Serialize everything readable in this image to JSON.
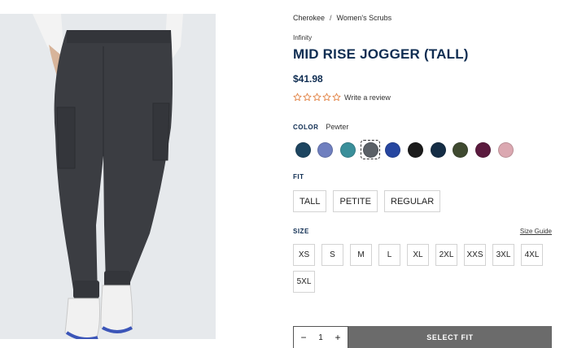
{
  "breadcrumb": {
    "items": [
      "Cherokee",
      "Women's Scrubs"
    ],
    "separator": "/"
  },
  "product": {
    "collection": "Infinity",
    "title": "MID RISE JOGGER (TALL)",
    "price": "$41.98",
    "rating": {
      "stars": 5,
      "filled": 0,
      "review_link": "Write a review"
    },
    "image_icon": "product-photo"
  },
  "color": {
    "label": "COLOR",
    "selected_name": "Pewter",
    "swatches": [
      "#1d4560",
      "#6f7fbf",
      "#3a8f9a",
      "#5b6167",
      "#2646a0",
      "#1b1b1b",
      "#152d45",
      "#3f4a30",
      "#5b1a3e",
      "#dba8b1"
    ],
    "selected_index": 3
  },
  "fit": {
    "label": "FIT",
    "options": [
      "TALL",
      "PETITE",
      "REGULAR"
    ]
  },
  "size": {
    "label": "SIZE",
    "guide_link": "Size Guide",
    "options": [
      "XS",
      "S",
      "M",
      "L",
      "XL",
      "2XL",
      "XXS",
      "3XL",
      "4XL",
      "5XL"
    ]
  },
  "cart": {
    "minus": "−",
    "quantity": "1",
    "plus": "+",
    "button_label": "SELECT FIT"
  },
  "colors": {
    "accent": "#0f2d52",
    "star_outline": "#e07b39",
    "button_bg": "#6b6b6b"
  }
}
